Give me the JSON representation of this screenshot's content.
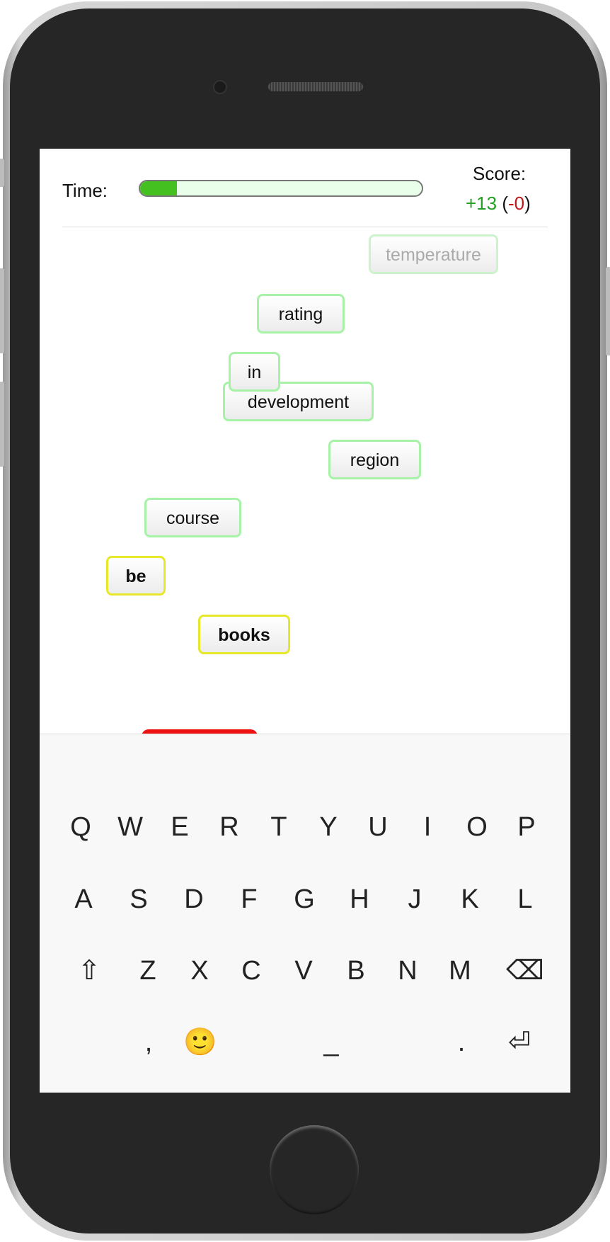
{
  "header": {
    "time_label": "Time:",
    "progress_fraction": 0.13,
    "score_label": "Score:",
    "score_plus": "+13",
    "score_open": "(",
    "score_minus": "-0",
    "score_close": ")"
  },
  "words": [
    {
      "text": "temperature",
      "state": "faded"
    },
    {
      "text": "rating",
      "state": "normal"
    },
    {
      "text": "development",
      "state": "normal"
    },
    {
      "text": "in",
      "state": "normal"
    },
    {
      "text": "region",
      "state": "normal"
    },
    {
      "text": "course",
      "state": "normal"
    },
    {
      "text": "be",
      "state": "highlighted"
    },
    {
      "text": "books",
      "state": "highlighted"
    }
  ],
  "keyboard": {
    "row1": [
      "Q",
      "W",
      "E",
      "R",
      "T",
      "Y",
      "U",
      "I",
      "O",
      "P"
    ],
    "row2": [
      "A",
      "S",
      "D",
      "F",
      "G",
      "H",
      "J",
      "K",
      "L"
    ],
    "row3": [
      "⇧",
      "Z",
      "X",
      "C",
      "V",
      "B",
      "N",
      "M",
      "⌫"
    ],
    "row4": [
      ",",
      "🙂",
      "_",
      ".",
      "⏎"
    ]
  },
  "colors": {
    "progress_fill": "#44c021",
    "progress_track": "#eaffea",
    "score_plus": "#21a021",
    "score_minus": "#c01818",
    "word_border": "#a8f2a8",
    "word_highlight_border": "#e8e82a"
  }
}
